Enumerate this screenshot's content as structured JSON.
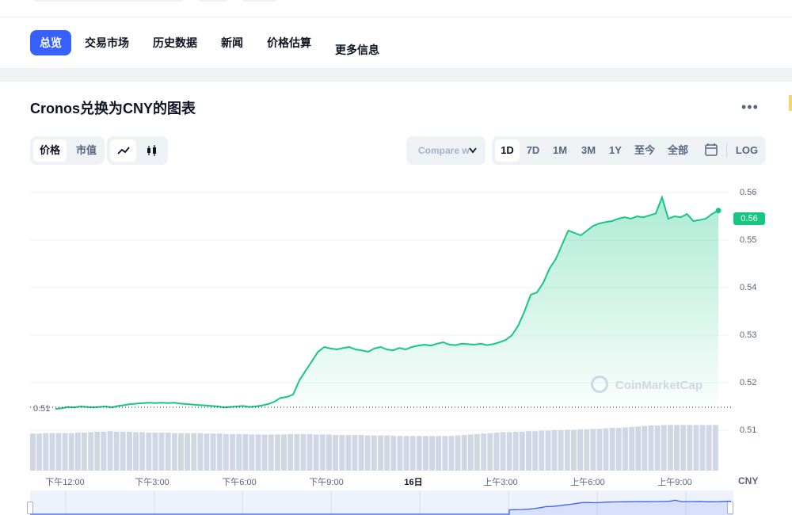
{
  "nav": {
    "items": [
      {
        "label": "总览",
        "active": true
      },
      {
        "label": "交易市场",
        "active": false
      },
      {
        "label": "历史数据",
        "active": false
      },
      {
        "label": "新闻",
        "active": false
      },
      {
        "label": "价格估算",
        "active": false
      },
      {
        "label": "更多信息",
        "active": false
      }
    ]
  },
  "chart_header": {
    "title": "Cronos兑换为CNY的图表",
    "more_icon": "more-dots-icon"
  },
  "toolbar": {
    "mode_tabs": [
      {
        "label": "价格",
        "active": true
      },
      {
        "label": "市值",
        "active": false
      }
    ],
    "chart_types": [
      {
        "icon": "line-chart-icon",
        "active": true
      },
      {
        "icon": "candlestick-icon",
        "active": false
      }
    ],
    "compare_label": "Compare w",
    "ranges": [
      {
        "label": "1D",
        "active": true
      },
      {
        "label": "7D",
        "active": false
      },
      {
        "label": "1M",
        "active": false
      },
      {
        "label": "3M",
        "active": false
      },
      {
        "label": "1Y",
        "active": false
      },
      {
        "label": "至今",
        "active": false
      },
      {
        "label": "全部",
        "active": false
      }
    ],
    "calendar_icon": "calendar-icon",
    "log_label": "LOG"
  },
  "colors": {
    "accent": "#3861fb",
    "up": "#16c784",
    "text": "#0d1421",
    "muted": "#58667e"
  },
  "chart_data": {
    "type": "area",
    "y_ticks": [
      "0.56",
      "0.55",
      "0.54",
      "0.53",
      "0.52",
      "0.51"
    ],
    "ylim": [
      0.5105,
      0.5605
    ],
    "x_ticks": [
      "下午12:00",
      "下午3:00",
      "下午6:00",
      "下午9:00",
      "16日",
      "上午3:00",
      "上午6:00",
      "上午9:00"
    ],
    "x_unit_label": "CNY",
    "current_price": "0.56",
    "open_price_label": "0.51",
    "watermark": "CoinMarketCap",
    "series": [
      {
        "values": [
          0.5145,
          0.5146,
          0.5149,
          0.5148,
          0.515,
          0.5149,
          0.5148,
          0.5149,
          0.515,
          0.5148,
          0.5151,
          0.5153,
          0.5155,
          0.5156,
          0.5157,
          0.5158,
          0.5157,
          0.5158,
          0.5157,
          0.5158,
          0.5156,
          0.5155,
          0.5154,
          0.5153,
          0.5152,
          0.5151,
          0.515,
          0.5148,
          0.5149,
          0.515,
          0.5151,
          0.5149,
          0.515,
          0.5152,
          0.5155,
          0.516,
          0.5168,
          0.517,
          0.5175,
          0.5205,
          0.5225,
          0.5245,
          0.5265,
          0.5275,
          0.5272,
          0.527,
          0.5273,
          0.5275,
          0.527,
          0.5268,
          0.5265,
          0.5272,
          0.5275,
          0.527,
          0.5268,
          0.5273,
          0.527,
          0.5275,
          0.5278,
          0.528,
          0.5278,
          0.5282,
          0.5285,
          0.528,
          0.5279,
          0.5282,
          0.5281,
          0.528,
          0.5282,
          0.5279,
          0.5281,
          0.5285,
          0.529,
          0.53,
          0.532,
          0.535,
          0.5385,
          0.539,
          0.541,
          0.544,
          0.546,
          0.549,
          0.552,
          0.5515,
          0.551,
          0.552,
          0.553,
          0.5535,
          0.5538,
          0.554,
          0.5545,
          0.5548,
          0.5545,
          0.555,
          0.5548,
          0.5552,
          0.5556,
          0.559,
          0.5545,
          0.555,
          0.5548,
          0.5555,
          0.554,
          0.5542,
          0.5545,
          0.5555,
          0.5562
        ]
      }
    ],
    "volume": [
      0.78,
      0.78,
      0.79,
      0.79,
      0.79,
      0.79,
      0.79,
      0.8,
      0.8,
      0.81,
      0.82,
      0.82,
      0.83,
      0.82,
      0.82,
      0.82,
      0.81,
      0.81,
      0.8,
      0.8,
      0.8,
      0.8,
      0.79,
      0.79,
      0.79,
      0.79,
      0.79,
      0.78,
      0.78,
      0.78,
      0.77,
      0.77,
      0.77,
      0.77,
      0.76,
      0.76,
      0.76,
      0.76,
      0.76,
      0.76,
      0.77,
      0.77,
      0.77,
      0.77,
      0.76,
      0.76,
      0.76,
      0.75,
      0.75,
      0.75,
      0.75,
      0.75,
      0.74,
      0.74,
      0.74,
      0.74,
      0.73,
      0.73,
      0.73,
      0.73,
      0.73,
      0.73,
      0.73,
      0.73,
      0.73,
      0.73,
      0.74,
      0.75,
      0.76,
      0.77,
      0.78,
      0.79,
      0.8,
      0.81,
      0.81,
      0.82,
      0.82,
      0.83,
      0.83,
      0.84,
      0.84,
      0.85,
      0.85,
      0.86,
      0.86,
      0.87,
      0.87,
      0.88,
      0.88,
      0.89,
      0.9,
      0.9,
      0.91,
      0.92,
      0.93,
      0.94,
      0.95,
      0.95,
      0.96,
      0.96,
      0.96,
      0.96,
      0.96,
      0.96,
      0.96,
      0.96,
      0.96
    ]
  }
}
